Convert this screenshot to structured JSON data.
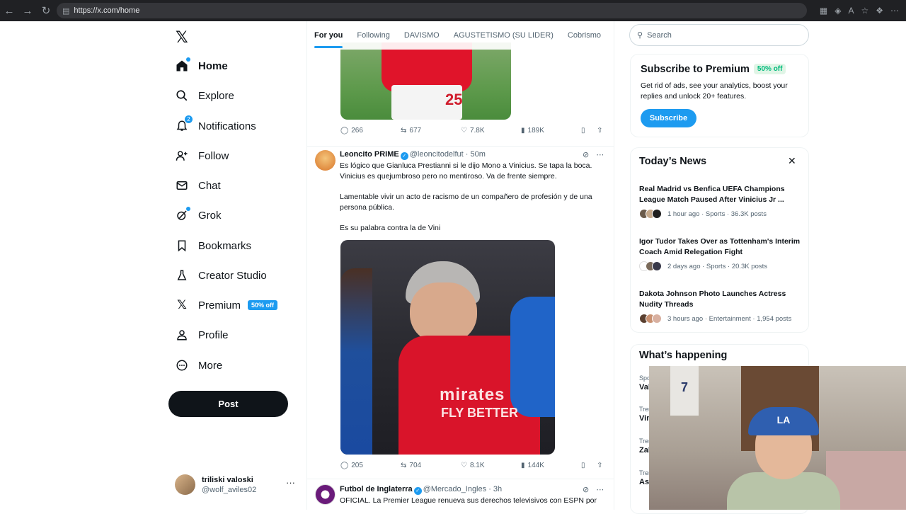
{
  "browser": {
    "url": "https://x.com/home"
  },
  "sidebar": {
    "logo": "𝕏",
    "items": [
      {
        "label": "Home",
        "icon": "home-icon"
      },
      {
        "label": "Explore",
        "icon": "search-icon"
      },
      {
        "label": "Notifications",
        "icon": "bell-icon",
        "badge": "2"
      },
      {
        "label": "Follow",
        "icon": "follow-icon"
      },
      {
        "label": "Chat",
        "icon": "mail-icon"
      },
      {
        "label": "Grok",
        "icon": "grok-icon"
      },
      {
        "label": "Bookmarks",
        "icon": "bookmark-icon"
      },
      {
        "label": "Creator Studio",
        "icon": "flask-icon"
      },
      {
        "label": "Premium",
        "icon": "x-logo-icon",
        "pill": "50% off"
      },
      {
        "label": "Profile",
        "icon": "person-icon"
      },
      {
        "label": "More",
        "icon": "more-circle-icon"
      }
    ],
    "post_label": "Post",
    "account": {
      "name": "triliski valoski",
      "handle": "@wolf_aviles02",
      "more": "···"
    }
  },
  "main": {
    "tabs": [
      "For you",
      "Following",
      "DAVISMO",
      "AGUSTETISMO (SU LIDER)",
      "Cobrismo"
    ],
    "tweet1": {
      "jersey_number": "25",
      "replies": "266",
      "retweets": "677",
      "likes": "7.8K",
      "views": "189K"
    },
    "tweet2": {
      "name": "Leoncito PRIME",
      "handle": "@leoncitodelfut",
      "time": "· 50m",
      "text1": "Es lógico que Gianluca Prestianni  si le dijo Mono a Vinicius.  Se tapa la boca. Vinicius es quejumbroso pero no mentiroso. Va de frente siempre.",
      "text2": "Lamentable vivir un acto de racismo de un compañero de profesión y de una persona pública.",
      "text3": "Es su palabra contra la de Vini",
      "image_text1": "mirates",
      "image_text2": "FLY BETTER",
      "replies": "205",
      "retweets": "704",
      "likes": "8.1K",
      "views": "144K"
    },
    "tweet3": {
      "name": "Futbol de Inglaterra",
      "handle": "@Mercado_Ingles",
      "time": "· 3h",
      "text": "OFICIAL. La Premier League renueva sus derechos televisivos con ESPN por"
    }
  },
  "right": {
    "search_placeholder": "Search",
    "premium": {
      "title": "Subscribe to Premium",
      "pill": "50% off",
      "desc": "Get rid of ads, see your analytics, boost your replies and unlock 20+ features.",
      "button": "Subscribe"
    },
    "news": {
      "title": "Today’s News",
      "close": "✕",
      "items": [
        {
          "title": "Real Madrid vs Benfica UEFA Champions League Match Paused After Vinicius Jr ...",
          "meta": "1 hour ago · Sports · 36.3K posts"
        },
        {
          "title": "Igor Tudor Takes Over as Tottenham's Interim Coach Amid Relegation Fight",
          "meta": "2 days ago · Sports · 20.3K posts"
        },
        {
          "title": "Dakota Johnson Photo Launches Actress Nudity Threads",
          "meta": "3 hours ago · Entertainment · 1,954 posts"
        }
      ]
    },
    "happening": {
      "title": "What’s happening",
      "rows": [
        {
          "label": "Spo",
          "value": "Val"
        },
        {
          "label": "Tren",
          "value": "Vin"
        },
        {
          "label": "Tren",
          "value": "Zal"
        },
        {
          "label": "Tren",
          "value": "Ass"
        }
      ]
    }
  },
  "webcam": {
    "cap_logo": "LA",
    "jersey_number": "7"
  }
}
